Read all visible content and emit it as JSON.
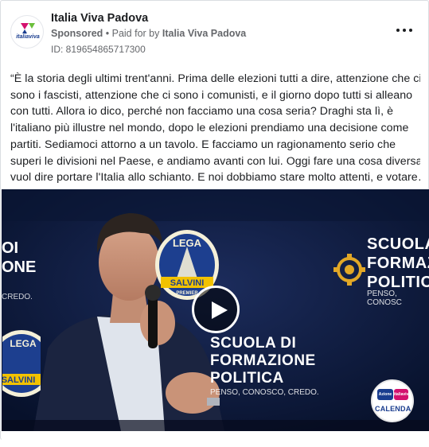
{
  "post": {
    "page_name": "Italia Viva Padova",
    "sponsored_label": "Sponsored",
    "paid_for_prefix": " • Paid for by ",
    "payer": "Italia Viva Padova",
    "ad_id": "ID: 819654865717300",
    "body_lines": [
      "“È la storia degli ultimi trent'anni. Prima delle elezioni tutti a dire, attenzione che ci",
      "sono i fascisti, attenzione che ci sono i comunisti, e il giorno dopo tutti si alleano",
      "con tutti. Allora io dico, perché non facciamo una cosa seria? Draghi sta lì, è",
      "l'italiano più illustre nel mondo, dopo le elezioni prendiamo una decisione come",
      "partiti. Sediamoci attorno a un tavolo. E facciamo un ragionamento serio che",
      "superi le divisioni nel Paese, e andiamo avanti con lui. Oggi fare una cosa diversa",
      "vuol dire portare l'Italia allo schianto. E noi dobbiamo stare molto attenti, e votare…"
    ],
    "avatar_logo_text": "italiaviva"
  },
  "video": {
    "backdrop_right": [
      "SCUOLA",
      "FORMAZ",
      "POLITIC",
      "PENSO, CONOSC"
    ],
    "backdrop_center": [
      "SCUOLA DI",
      "FORMAZIONE",
      "POLITICA",
      "PENSO, CONOSCO, CREDO."
    ],
    "backdrop_left": [
      "OI",
      "ONE",
      "CREDO."
    ],
    "lega_logo_text": [
      "LEGA",
      "SALVINI",
      "PREMIER"
    ],
    "badge": {
      "chip_a": "Azione",
      "chip_b": "italiaviva",
      "label": "CALENDA"
    },
    "colors": {
      "backdrop": "#0d1b3f",
      "lega_blue": "#1d3f8f",
      "lega_gold": "#f2c200",
      "accent_gold": "#e2a826"
    }
  },
  "icons": {
    "more": "more-horizontal-icon",
    "play": "play-icon"
  }
}
